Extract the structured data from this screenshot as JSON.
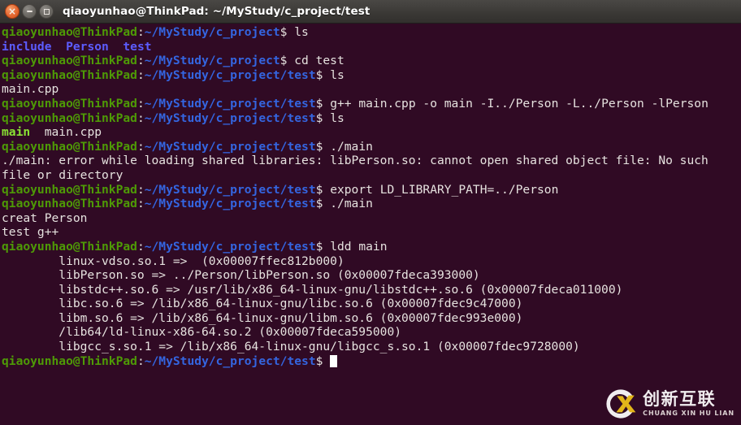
{
  "window": {
    "title": "qiaoyunhao@ThinkPad: ~/MyStudy/c_project/test",
    "controls": {
      "close_label": "×",
      "minimize_label": "",
      "maximize_label": ""
    }
  },
  "colors": {
    "background": "#300a24",
    "titlebar": "#3b3936",
    "foreground": "#e6e2df",
    "prompt_user": "#4e9a06",
    "prompt_path": "#3465e0",
    "dir_blue": "#5c5cff",
    "exec_green": "#8ae234",
    "close_button": "#e8703a",
    "watermark_accent": "#f0c419"
  },
  "prompt": {
    "user_host": "qiaoyunhao@ThinkPad",
    "separator": ":",
    "sigil": "$",
    "path_project": "~/MyStudy/c_project",
    "path_test": "~/MyStudy/c_project/test"
  },
  "terminal": {
    "lines": [
      {
        "type": "prompt",
        "path": "~/MyStudy/c_project",
        "command": " ls"
      },
      {
        "type": "output",
        "segments": [
          {
            "text": "include",
            "color": "dirblue"
          },
          {
            "text": "  ",
            "color": "white"
          },
          {
            "text": "Person",
            "color": "dirblue"
          },
          {
            "text": "  ",
            "color": "white"
          },
          {
            "text": "test",
            "color": "dirblue"
          }
        ]
      },
      {
        "type": "prompt",
        "path": "~/MyStudy/c_project",
        "command": " cd test"
      },
      {
        "type": "prompt",
        "path": "~/MyStudy/c_project/test",
        "command": " ls"
      },
      {
        "type": "output",
        "segments": [
          {
            "text": "main.cpp",
            "color": "white"
          }
        ]
      },
      {
        "type": "prompt",
        "path": "~/MyStudy/c_project/test",
        "command": " g++ main.cpp -o main -I../Person -L../Person -lPerson"
      },
      {
        "type": "prompt",
        "path": "~/MyStudy/c_project/test",
        "command": " ls"
      },
      {
        "type": "output",
        "segments": [
          {
            "text": "main",
            "color": "exec"
          },
          {
            "text": "  ",
            "color": "white"
          },
          {
            "text": "main.cpp",
            "color": "white"
          }
        ]
      },
      {
        "type": "prompt",
        "path": "~/MyStudy/c_project/test",
        "command": " ./main"
      },
      {
        "type": "output",
        "segments": [
          {
            "text": "./main: error while loading shared libraries: libPerson.so: cannot open shared object file: No such",
            "color": "white"
          }
        ]
      },
      {
        "type": "output",
        "segments": [
          {
            "text": "file or directory",
            "color": "white"
          }
        ]
      },
      {
        "type": "prompt",
        "path": "~/MyStudy/c_project/test",
        "command": " export LD_LIBRARY_PATH=../Person"
      },
      {
        "type": "prompt",
        "path": "~/MyStudy/c_project/test",
        "command": " ./main"
      },
      {
        "type": "output",
        "segments": [
          {
            "text": "creat Person",
            "color": "white"
          }
        ]
      },
      {
        "type": "output",
        "segments": [
          {
            "text": "test g++",
            "color": "white"
          }
        ]
      },
      {
        "type": "prompt",
        "path": "~/MyStudy/c_project/test",
        "command": " ldd main"
      },
      {
        "type": "output",
        "segments": [
          {
            "text": "        linux-vdso.so.1 =>  (0x00007ffec812b000)",
            "color": "white"
          }
        ]
      },
      {
        "type": "output",
        "segments": [
          {
            "text": "        libPerson.so => ../Person/libPerson.so (0x00007fdeca393000)",
            "color": "white"
          }
        ]
      },
      {
        "type": "output",
        "segments": [
          {
            "text": "        libstdc++.so.6 => /usr/lib/x86_64-linux-gnu/libstdc++.so.6 (0x00007fdeca011000)",
            "color": "white"
          }
        ]
      },
      {
        "type": "output",
        "segments": [
          {
            "text": "        libc.so.6 => /lib/x86_64-linux-gnu/libc.so.6 (0x00007fdec9c47000)",
            "color": "white"
          }
        ]
      },
      {
        "type": "output",
        "segments": [
          {
            "text": "        libm.so.6 => /lib/x86_64-linux-gnu/libm.so.6 (0x00007fdec993e000)",
            "color": "white"
          }
        ]
      },
      {
        "type": "output",
        "segments": [
          {
            "text": "        /lib64/ld-linux-x86-64.so.2 (0x00007fdeca595000)",
            "color": "white"
          }
        ]
      },
      {
        "type": "output",
        "segments": [
          {
            "text": "        libgcc_s.so.1 => /lib/x86_64-linux-gnu/libgcc_s.so.1 (0x00007fdec9728000)",
            "color": "white"
          }
        ]
      },
      {
        "type": "prompt",
        "path": "~/MyStudy/c_project/test",
        "command": " ",
        "cursor": true
      }
    ]
  },
  "watermark": {
    "chinese": "创新互联",
    "pinyin": "CHUANG XIN HU LIAN",
    "logo_letter": "C"
  }
}
